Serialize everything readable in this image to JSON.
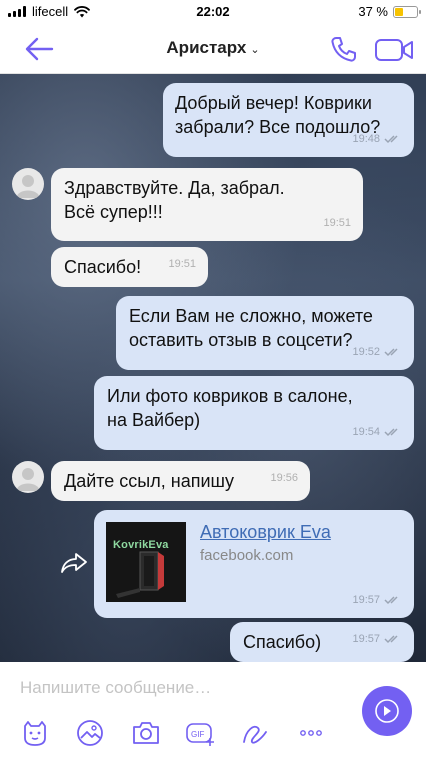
{
  "status_bar": {
    "carrier": "lifecell",
    "time": "22:02",
    "battery": "37 %",
    "battery_level": 0.37
  },
  "header": {
    "contact_name": "Аристарх"
  },
  "messages": [
    {
      "direction": "out",
      "text": "Добрый вечер! Коврики\nзабрали? Все подошло?",
      "time": "19:48"
    },
    {
      "direction": "in",
      "text": "Здравствуйте. Да, забрал.\nВсё супер!!!",
      "time": "19:51"
    },
    {
      "direction": "in",
      "text": "Спасибо!",
      "time": "19:51"
    },
    {
      "direction": "out",
      "text": "Если Вам не сложно, можете\nоставить отзыв в соцсети?",
      "time": "19:52"
    },
    {
      "direction": "out",
      "text": "Или фото ковриков в салоне,\nна Вайбер)",
      "time": "19:54"
    },
    {
      "direction": "in",
      "text": "Дайте ссыл, напишу",
      "time": "19:56"
    },
    {
      "direction": "out",
      "type": "link",
      "link_title": "Автоковрик Eva",
      "link_domain": "facebook.com",
      "thumb_label": "KovrikEva",
      "time": "19:57"
    },
    {
      "direction": "out",
      "text": "Спасибо)",
      "time": "19:57"
    }
  ],
  "composer": {
    "placeholder": "Напишите сообщение…"
  },
  "toolbar": {
    "icons": [
      "sticker-icon",
      "gallery-icon",
      "camera-icon",
      "gif-icon",
      "doodle-icon",
      "more-icon"
    ],
    "gif_label": "GIF"
  },
  "colors": {
    "accent": "#7360f2",
    "outgoing_bubble": "#d9e4f7",
    "incoming_bubble": "#f3f3f3",
    "link": "#3f6cb5"
  }
}
